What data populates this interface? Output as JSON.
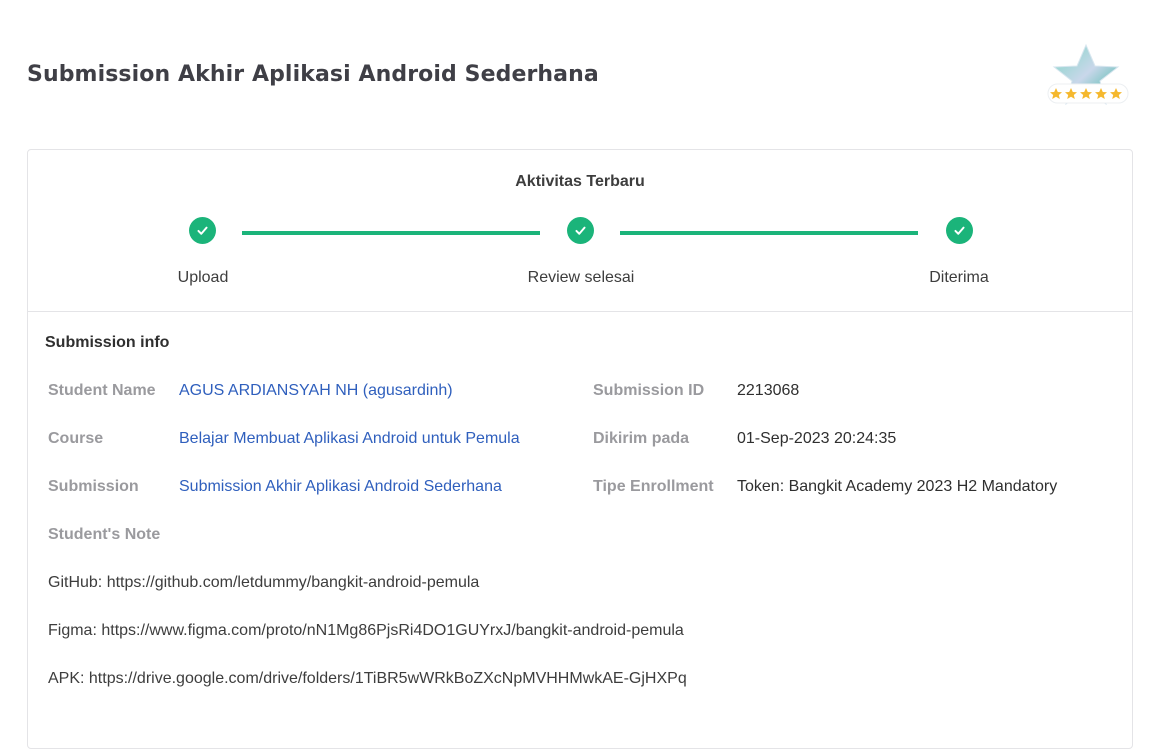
{
  "page": {
    "title": "Submission Akhir Aplikasi Android Sederhana"
  },
  "badge": {
    "icon": "five-star-rating-badge-icon",
    "stars": 5,
    "star_color": "#f5b82e"
  },
  "colors": {
    "accent": "#1bb47a",
    "link": "#2f5fbd",
    "label": "#9a9a9e"
  },
  "activity": {
    "title": "Aktivitas Terbaru",
    "steps": [
      {
        "label": "Upload",
        "status": "done",
        "icon": "check-icon"
      },
      {
        "label": "Review selesai",
        "status": "done",
        "icon": "check-icon"
      },
      {
        "label": "Diterima",
        "status": "done",
        "icon": "check-icon"
      }
    ]
  },
  "info": {
    "title": "Submission info",
    "student_name": {
      "label": "Student Name",
      "value": "AGUS ARDIANSYAH NH (agusardinh)"
    },
    "course": {
      "label": "Course",
      "value": "Belajar Membuat Aplikasi Android untuk Pemula"
    },
    "submission": {
      "label": "Submission",
      "value": "Submission Akhir Aplikasi Android Sederhana"
    },
    "submission_id": {
      "label": "Submission ID",
      "value": "2213068"
    },
    "sent_at": {
      "label": "Dikirim pada",
      "value": "01-Sep-2023 20:24:35"
    },
    "enrollment_type": {
      "label": "Tipe Enrollment",
      "value": "Token: Bangkit Academy 2023 H2 Mandatory"
    },
    "note": {
      "label": "Student's Note",
      "lines": [
        "GitHub: https://github.com/letdummy/bangkit-android-pemula",
        "Figma: https://www.figma.com/proto/nN1Mg86PjsRi4DO1GUYrxJ/bangkit-android-pemula",
        "APK: https://drive.google.com/drive/folders/1TiBR5wWRkBoZXcNpMVHHMwkAE-GjHXPq"
      ]
    }
  }
}
